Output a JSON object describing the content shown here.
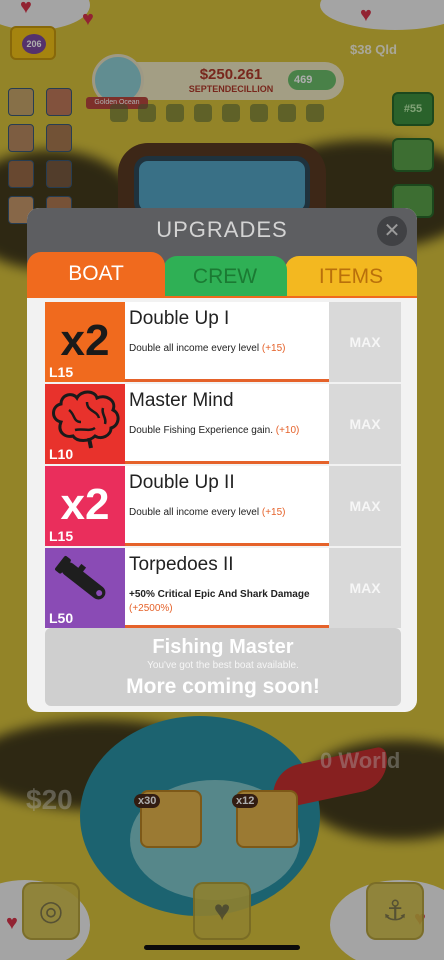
{
  "hud": {
    "level": "206",
    "money_amount": "$250.261",
    "money_unit": "SEPTENDECILLION",
    "pearls": "469",
    "boat_name": "Golden Ocean",
    "gold": "$38 Qld",
    "tier_number": "#55"
  },
  "background": {
    "multiplier_1": "x30",
    "multiplier_2": "x12",
    "faded_left": "$20",
    "faded_right": "0 World"
  },
  "modal": {
    "title": "UPGRADES",
    "close_label": "✕",
    "tabs": {
      "boat": "BOAT",
      "crew": "CREW",
      "items": "ITEMS"
    },
    "upgrades": [
      {
        "name": "Double Up I",
        "description": "Double all income every level",
        "bonus": "(+15)",
        "level": "L15",
        "action": "MAX",
        "icon": "x2",
        "color": "#f06a1e"
      },
      {
        "name": "Master Mind",
        "description": "Double Fishing Experience gain.",
        "bonus": "(+10)",
        "level": "L10",
        "action": "MAX",
        "icon": "brain-icon",
        "color": "#e8322c"
      },
      {
        "name": "Double Up II",
        "description": "Double all income every level",
        "bonus": "(+15)",
        "level": "L15",
        "action": "MAX",
        "icon": "x2",
        "color": "#ea2e5c"
      },
      {
        "name": "Torpedoes II",
        "description": "+50% Critical Epic And Shark Damage",
        "bonus": "(+2500%)",
        "level": "L50",
        "action": "MAX",
        "icon": "torpedo-icon",
        "color": "#8a4bb5"
      }
    ],
    "footer": {
      "title": "Fishing Master",
      "subtitle": "You've got the best boat available.",
      "more": "More coming soon!"
    }
  }
}
